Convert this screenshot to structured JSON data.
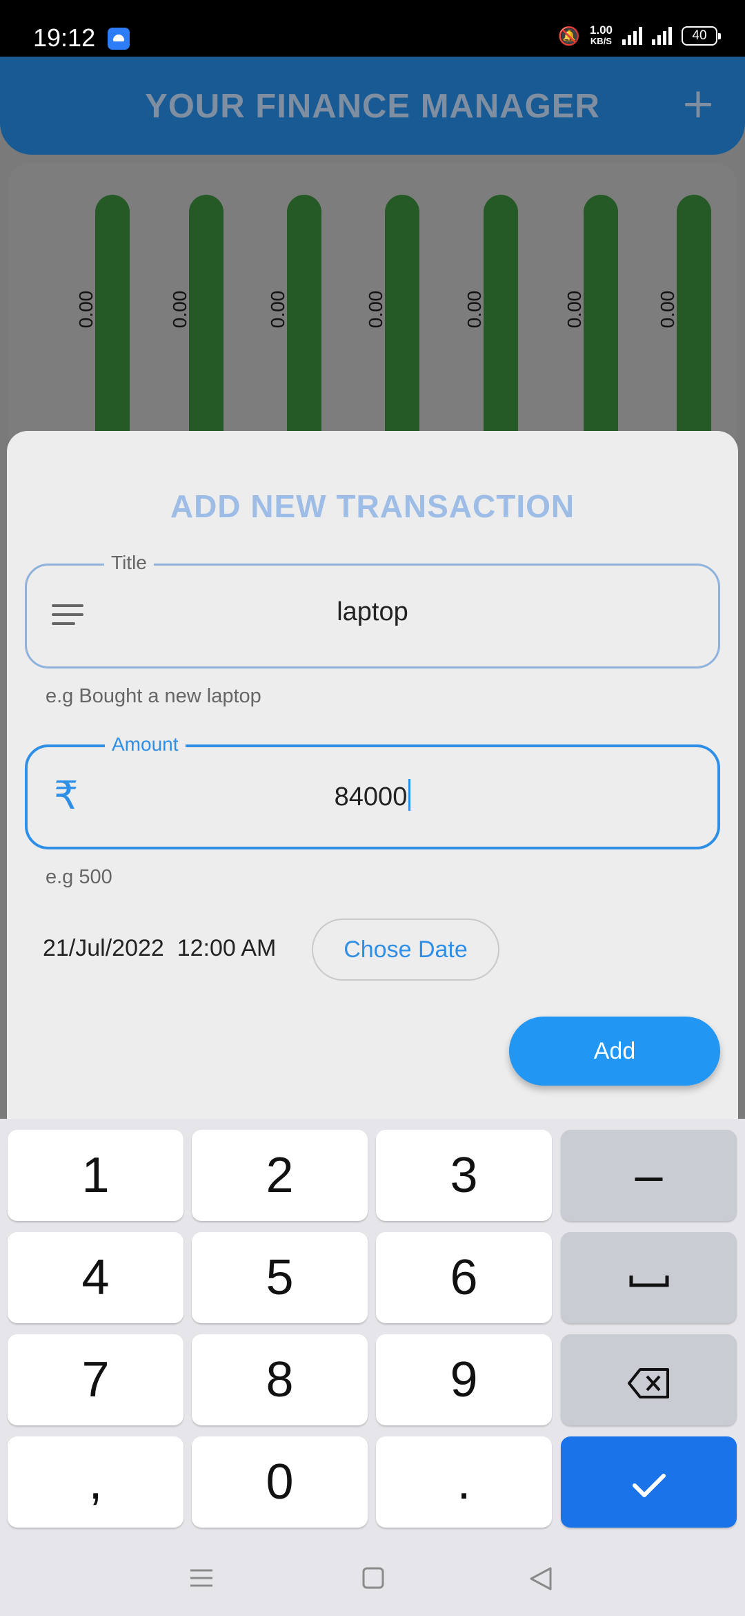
{
  "status_bar": {
    "time": "19:12",
    "speed_value": "1.00",
    "speed_unit": "KB/S",
    "battery": "40"
  },
  "app_bar": {
    "title": "YOUR FINANCE MANAGER"
  },
  "chart": {
    "bar_labels": [
      "0.00",
      "0.00",
      "0.00",
      "0.00",
      "0.00",
      "0.00",
      "0.00"
    ],
    "bar_color": "#255a27"
  },
  "sheet": {
    "title": "ADD NEW TRANSACTION",
    "title_field": {
      "legend": "Title",
      "value": "laptop",
      "helper": "e.g Bought a new laptop"
    },
    "amount_field": {
      "legend": "Amount",
      "prefix": "₹",
      "value": "84000",
      "helper": "e.g 500"
    },
    "date_text": "21/Jul/2022  12:00 AM",
    "chose_date_label": "Chose Date",
    "add_label": "Add"
  },
  "keyboard": {
    "keys": [
      "1",
      "2",
      "3",
      "–",
      "4",
      "5",
      "6",
      "␣",
      "7",
      "8",
      "9",
      "⌫",
      ",",
      "0",
      ".",
      "✓"
    ]
  },
  "colors": {
    "accent": "#2196f3",
    "app_bar": "#175a94",
    "keyboard_done": "#1a73e8"
  }
}
